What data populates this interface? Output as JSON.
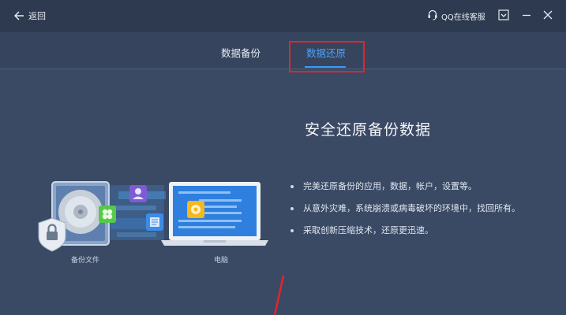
{
  "titlebar": {
    "back_label": "返回",
    "qq_service_label": "QQ在线客服"
  },
  "tabs": [
    {
      "label": "数据备份",
      "active": false
    },
    {
      "label": "数据还原",
      "active": true
    }
  ],
  "main": {
    "heading": "安全还原备份数据",
    "features": [
      "完美还原备份的应用，数据，帐户，设置等。",
      "从意外灾难，系统崩溃或病毒破坏的环境中，找回所有。",
      "采取创新压缩技术，还原更迅速。"
    ]
  },
  "illustration": {
    "backup_file_label": "备份文件",
    "computer_label": "电脑"
  },
  "colors": {
    "background": "#3a4964",
    "titlebar": "#2e3a50",
    "active_tab": "#4aa3ff",
    "highlight_box": "#e0262c"
  }
}
